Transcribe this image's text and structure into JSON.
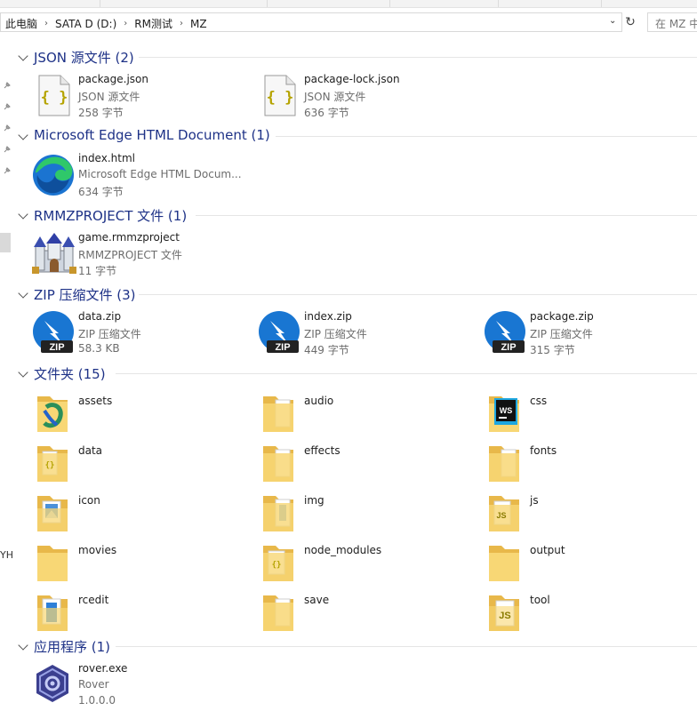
{
  "address": {
    "crumbs": [
      "此电脑",
      "SATA D (D:)",
      "RM测试",
      "MZ"
    ]
  },
  "search": {
    "placeholder": "在 MZ 中"
  },
  "nav": {
    "fragment": "YH"
  },
  "groups": [
    {
      "title": "JSON 源文件 (2)",
      "items": [
        {
          "name": "package.json",
          "type": "JSON 源文件",
          "size": "258 字节",
          "icon": "json-file-icon"
        },
        {
          "name": "package-lock.json",
          "type": "JSON 源文件",
          "size": "636 字节",
          "icon": "json-file-icon"
        }
      ]
    },
    {
      "title": "Microsoft Edge HTML Document (1)",
      "items": [
        {
          "name": "index.html",
          "type": "Microsoft Edge HTML Docum...",
          "size": "634 字节",
          "icon": "edge-icon"
        }
      ]
    },
    {
      "title": "RMMZPROJECT 文件 (1)",
      "items": [
        {
          "name": "game.rmmzproject",
          "type": "RMMZPROJECT 文件",
          "size": "11 字节",
          "icon": "castle-icon"
        }
      ]
    },
    {
      "title": "ZIP 压缩文件 (3)",
      "items": [
        {
          "name": "data.zip",
          "type": "ZIP 压缩文件",
          "size": "58.3 KB",
          "icon": "zip-icon"
        },
        {
          "name": "index.zip",
          "type": "ZIP 压缩文件",
          "size": "449 字节",
          "icon": "zip-icon"
        },
        {
          "name": "package.zip",
          "type": "ZIP 压缩文件",
          "size": "315 字节",
          "icon": "zip-icon"
        }
      ]
    },
    {
      "title": "文件夹 (15)",
      "folders": [
        {
          "name": "assets",
          "icon": "folder-assets-icon"
        },
        {
          "name": "audio",
          "icon": "folder-docs-icon"
        },
        {
          "name": "css",
          "icon": "folder-webstorm-icon"
        },
        {
          "name": "data",
          "icon": "folder-json-icon"
        },
        {
          "name": "effects",
          "icon": "folder-docs-icon"
        },
        {
          "name": "fonts",
          "icon": "folder-docs-icon"
        },
        {
          "name": "icon",
          "icon": "folder-image-icon"
        },
        {
          "name": "img",
          "icon": "folder-docs-icon"
        },
        {
          "name": "js",
          "icon": "folder-js-icon"
        },
        {
          "name": "movies",
          "icon": "folder-icon"
        },
        {
          "name": "node_modules",
          "icon": "folder-json-icon"
        },
        {
          "name": "output",
          "icon": "folder-icon"
        },
        {
          "name": "rcedit",
          "icon": "folder-blue-doc-icon"
        },
        {
          "name": "save",
          "icon": "folder-docs-icon"
        },
        {
          "name": "tool",
          "icon": "folder-js-icon"
        }
      ]
    },
    {
      "title": "应用程序 (1)",
      "items": [
        {
          "name": "rover.exe",
          "type": "Rover",
          "size": "1.0.0.0",
          "icon": "rover-app-icon"
        }
      ]
    }
  ],
  "colors": {
    "group_title": "#1e3287",
    "secondary_text": "#6d6d6d",
    "folder": "#f8d775",
    "zip_blue": "#1976d2"
  }
}
